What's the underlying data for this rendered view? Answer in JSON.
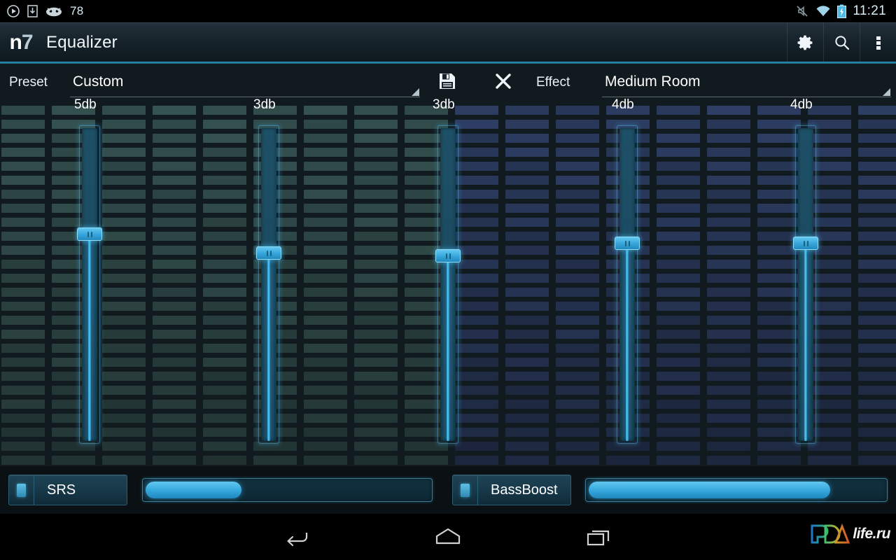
{
  "status_bar": {
    "time": "11:21",
    "battery_level": "78",
    "left_icons": [
      "play-circle-icon",
      "download-icon",
      "cyanogenmod-icon"
    ],
    "right_icons": [
      "silent-mode-icon",
      "wifi-icon",
      "battery-charging-icon"
    ]
  },
  "action_bar": {
    "logo_n": "n",
    "logo_7": "7",
    "title": "Equalizer",
    "actions": [
      {
        "name": "settings",
        "icon": "gear-icon"
      },
      {
        "name": "search",
        "icon": "search-icon"
      },
      {
        "name": "overflow",
        "icon": "overflow-menu-icon"
      }
    ],
    "accent_color": "#2d91b8"
  },
  "controls": {
    "preset_label": "Preset",
    "preset_value": "Custom",
    "save_icon": "floppy-save-icon",
    "delete_icon": "close-x-icon",
    "effect_label": "Effect",
    "effect_value": "Medium Room"
  },
  "equalizer": {
    "bands": [
      {
        "label": "5db",
        "value": 5,
        "fill_percent": 66
      },
      {
        "label": "3db",
        "value": 3,
        "fill_percent": 60
      },
      {
        "label": "3db",
        "value": 3,
        "fill_percent": 59
      },
      {
        "label": "4db",
        "value": 4,
        "fill_percent": 63
      },
      {
        "label": "4db",
        "value": 4,
        "fill_percent": 63
      }
    ],
    "slider_color": "#3daade",
    "track_color": "#1c4c63"
  },
  "effects": [
    {
      "name": "SRS",
      "label": "SRS",
      "enabled": true,
      "level_percent": 35
    },
    {
      "name": "BassBoost",
      "label": "BassBoost",
      "enabled": true,
      "level_percent": 82
    }
  ],
  "nav_bar": {
    "buttons": [
      {
        "name": "back",
        "icon": "back-arrow-icon"
      },
      {
        "name": "home",
        "icon": "home-icon"
      },
      {
        "name": "recents",
        "icon": "recent-apps-icon"
      }
    ]
  },
  "watermark": {
    "text": "life.ru",
    "logo": "PDA"
  }
}
